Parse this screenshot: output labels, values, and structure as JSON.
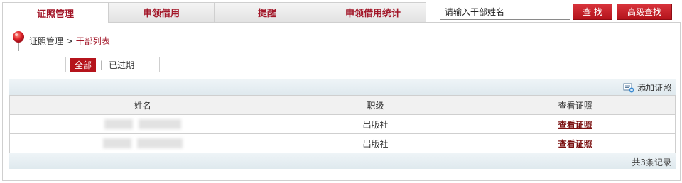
{
  "tabs": [
    {
      "label": "证照管理",
      "active": true
    },
    {
      "label": "申领借用",
      "active": false
    },
    {
      "label": "提醒",
      "active": false
    },
    {
      "label": "申领借用统计",
      "active": false
    }
  ],
  "search": {
    "value": "请输入干部姓名",
    "find_label": "查 找",
    "advanced_label": "高级查找"
  },
  "breadcrumb": {
    "root": "证照管理",
    "separator": " > ",
    "current": "干部列表"
  },
  "filter": {
    "all_label": "全部",
    "expired_label": "已过期"
  },
  "toolbar": {
    "add_label": "添加证照"
  },
  "table": {
    "headers": [
      "姓名",
      "职级",
      "查看证照"
    ],
    "rows": [
      {
        "rank": "出版社",
        "link": "查看证照"
      },
      {
        "rank": "出版社",
        "link": "查看证照"
      }
    ]
  },
  "footer": {
    "total": "共3条记录"
  },
  "colors": {
    "accent": "#b5141c",
    "tab_text": "#a3182a"
  }
}
